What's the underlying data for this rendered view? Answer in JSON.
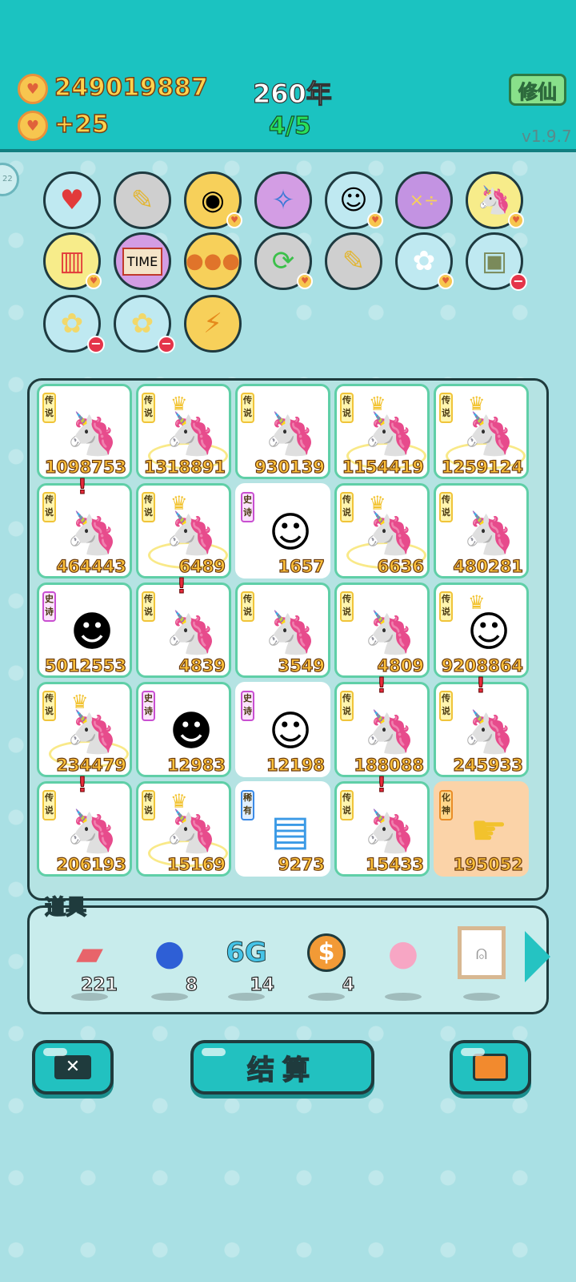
{
  "hud": {
    "gold": "249019887",
    "income": "+25",
    "year": "260年",
    "stage": "4/5",
    "xiuxian_label": "修仙",
    "version": "v1.9.7",
    "side_bubble": "22"
  },
  "items_row1": [
    "blood-bag",
    "screwdriver",
    "owl",
    "compass",
    "duo",
    "math-board",
    "unicorn"
  ],
  "items_row2": [
    "fries",
    "time-magazine",
    "basketballs",
    "recycle",
    "screwdriver",
    "rabbit",
    "money-bag"
  ],
  "items_row3": [
    "flower-pot",
    "flower-pot",
    "lightning"
  ],
  "tags": {
    "legend": "传说",
    "epic": "史诗",
    "rare": "稀有",
    "god": "化神"
  },
  "board": [
    [
      {
        "tag": "传说",
        "num": "1098753"
      },
      {
        "tag": "传说",
        "num": "1318891"
      },
      {
        "tag": "传说",
        "num": "930139"
      },
      {
        "tag": "传说",
        "num": "1154419"
      },
      {
        "tag": "传说",
        "num": "1259124"
      }
    ],
    [
      {
        "tag": "传说",
        "num": "464443"
      },
      {
        "tag": "传说",
        "num": "6489"
      },
      {
        "tag": "史诗",
        "num": "1657"
      },
      {
        "tag": "传说",
        "num": "6636"
      },
      {
        "tag": "传说",
        "num": "480281"
      }
    ],
    [
      {
        "tag": "史诗",
        "num": "5012553"
      },
      {
        "tag": "传说",
        "num": "4839"
      },
      {
        "tag": "传说",
        "num": "3549"
      },
      {
        "tag": "传说",
        "num": "4809"
      },
      {
        "tag": "传说",
        "num": "9208864"
      }
    ],
    [
      {
        "tag": "传说",
        "num": "234479"
      },
      {
        "tag": "史诗",
        "num": "12983"
      },
      {
        "tag": "史诗",
        "num": "12198"
      },
      {
        "tag": "传说",
        "num": "188088"
      },
      {
        "tag": "传说",
        "num": "245933"
      }
    ],
    [
      {
        "tag": "传说",
        "num": "206193"
      },
      {
        "tag": "传说",
        "num": "15169"
      },
      {
        "tag": "稀有",
        "num": "9273"
      },
      {
        "tag": "传说",
        "num": "15433"
      },
      {
        "tag": "化神",
        "num": "195052"
      }
    ]
  ],
  "props": {
    "label": "道具",
    "items": [
      {
        "name": "liver",
        "count": "221"
      },
      {
        "name": "blueberry",
        "count": "8"
      },
      {
        "name": "6G",
        "count": "14"
      },
      {
        "name": "dollar-coin",
        "count": "4"
      },
      {
        "name": "piggy-bank",
        "count": ""
      },
      {
        "name": "ghost-frame",
        "count": ""
      }
    ]
  },
  "buttons": {
    "settle": "结算"
  },
  "colors": {
    "teal": "#1bc3c1",
    "gold": "#ffd34d",
    "green": "#28e05a",
    "legend_tag": "#f0c43a",
    "epic_tag": "#c94fd1",
    "rare_tag": "#3b8ae6"
  }
}
